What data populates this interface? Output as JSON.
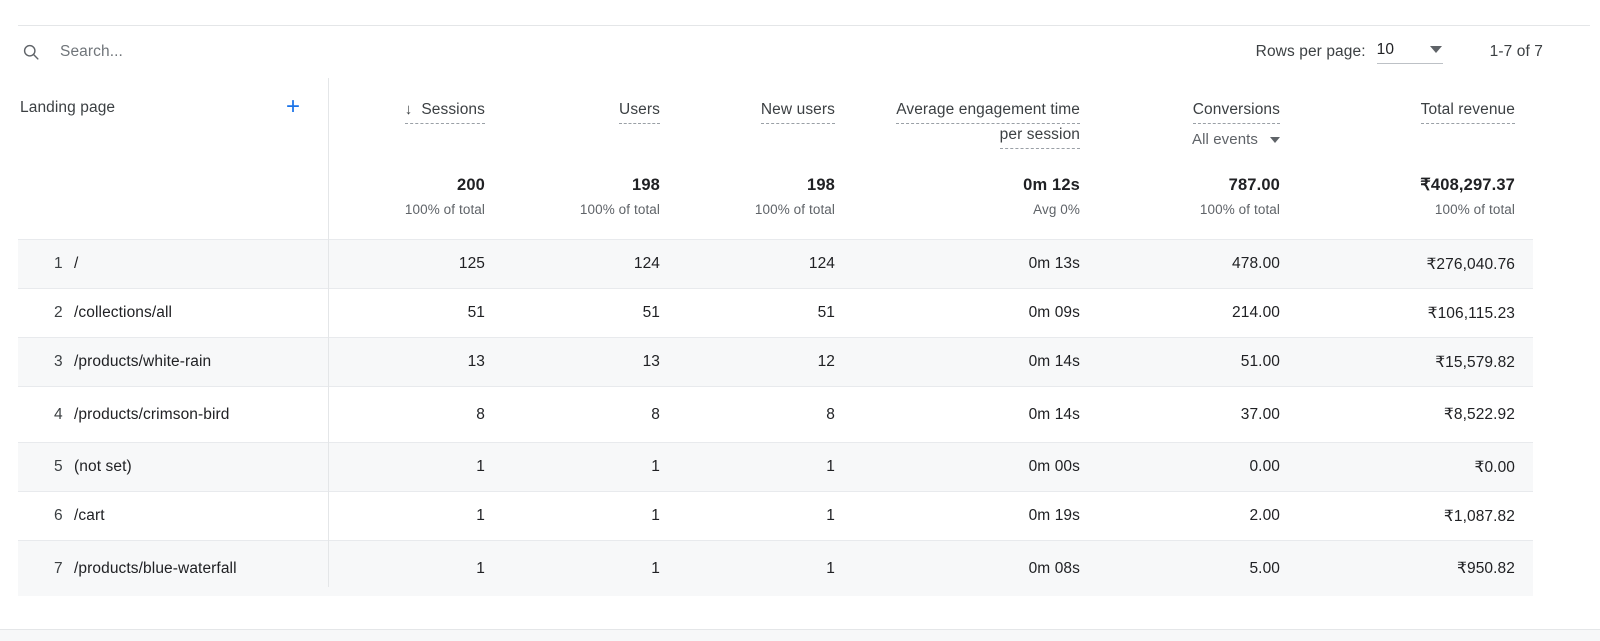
{
  "toolbar": {
    "search_placeholder": "Search...",
    "search_value": "",
    "search_icon": "search-icon",
    "rows_per_page_label": "Rows per page:",
    "rows_per_page_value": "10",
    "range_label": "1-7 of 7"
  },
  "table": {
    "dimension_header": "Landing page",
    "add_dimension_icon": "+",
    "sort_arrow": "↓",
    "sort_column": "Sessions",
    "columns": [
      {
        "label": "Sessions",
        "sorted": true
      },
      {
        "label": "Users",
        "sorted": false
      },
      {
        "label": "New users",
        "sorted": false
      },
      {
        "label": "Average engagement time",
        "label2": "per session",
        "sorted": false
      },
      {
        "label": "Conversions",
        "sublabel": "All events",
        "sorted": false
      },
      {
        "label": "Total revenue",
        "sorted": false
      }
    ],
    "totals": [
      {
        "value": "200",
        "sub": "100% of total"
      },
      {
        "value": "198",
        "sub": "100% of total"
      },
      {
        "value": "198",
        "sub": "100% of total"
      },
      {
        "value": "0m 12s",
        "sub": "Avg 0%"
      },
      {
        "value": "787.00",
        "sub": "100% of total"
      },
      {
        "value": "₹408,297.37",
        "sub": "100% of total"
      }
    ],
    "rows": [
      {
        "rank": "1",
        "dimension": "/",
        "sessions": "125",
        "users": "124",
        "new_users": "124",
        "avg_engagement": "0m 13s",
        "conversions": "478.00",
        "revenue": "₹276,040.76"
      },
      {
        "rank": "2",
        "dimension": "/collections/all",
        "sessions": "51",
        "users": "51",
        "new_users": "51",
        "avg_engagement": "0m 09s",
        "conversions": "214.00",
        "revenue": "₹106,115.23"
      },
      {
        "rank": "3",
        "dimension": "/products/white-rain",
        "sessions": "13",
        "users": "13",
        "new_users": "12",
        "avg_engagement": "0m 14s",
        "conversions": "51.00",
        "revenue": "₹15,579.82"
      },
      {
        "rank": "4",
        "dimension": "/products/crimson-bird",
        "sessions": "8",
        "users": "8",
        "new_users": "8",
        "avg_engagement": "0m 14s",
        "conversions": "37.00",
        "revenue": "₹8,522.92"
      },
      {
        "rank": "5",
        "dimension": "(not set)",
        "sessions": "1",
        "users": "1",
        "new_users": "1",
        "avg_engagement": "0m 00s",
        "conversions": "0.00",
        "revenue": "₹0.00"
      },
      {
        "rank": "6",
        "dimension": "/cart",
        "sessions": "1",
        "users": "1",
        "new_users": "1",
        "avg_engagement": "0m 19s",
        "conversions": "2.00",
        "revenue": "₹1,087.82"
      },
      {
        "rank": "7",
        "dimension": "/products/blue-waterfall",
        "sessions": "1",
        "users": "1",
        "new_users": "1",
        "avg_engagement": "0m 08s",
        "conversions": "5.00",
        "revenue": "₹950.82"
      }
    ]
  },
  "colors": {
    "accent": "#1a73e8",
    "row_shaded": "#f7f8f9",
    "text_primary": "#202124",
    "text_secondary": "#5f6368",
    "border": "#e8eaed"
  }
}
